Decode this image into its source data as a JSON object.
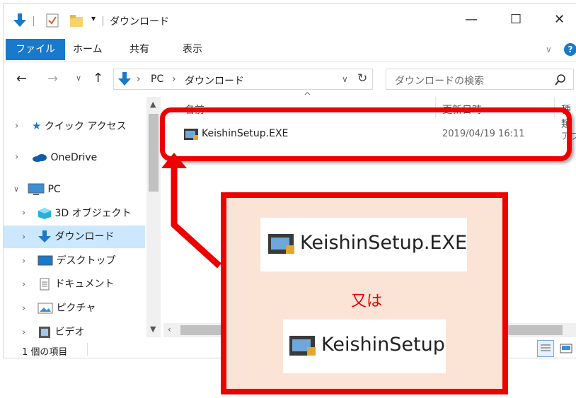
{
  "window": {
    "title": "ダウンロード",
    "qat_dropdown": "▾",
    "controls": {
      "minimize": "—",
      "maximize": "☐",
      "close": "✕"
    }
  },
  "ribbon": {
    "tabs": [
      "ファイル",
      "ホーム",
      "共有",
      "表示"
    ],
    "expand_chevron": "∨",
    "help": "?"
  },
  "nav": {
    "back": "←",
    "forward": "→",
    "recent": "∨",
    "up": "↑",
    "breadcrumb": [
      "PC",
      "ダウンロード"
    ],
    "breadcrumb_sep": "›",
    "dropdown": "∨",
    "refresh": "↻",
    "search_placeholder": "ダウンロードの検索"
  },
  "sidebar": {
    "items": [
      {
        "label": "クイック アクセス",
        "icon": "star-icon",
        "chevron": "›"
      },
      {
        "label": "OneDrive",
        "icon": "cloud-icon",
        "chevron": "›"
      },
      {
        "label": "PC",
        "icon": "monitor-icon",
        "chevron": "∨"
      },
      {
        "label": "3D オブジェクト",
        "icon": "cube-icon",
        "chevron": "›"
      },
      {
        "label": "ダウンロード",
        "icon": "download-icon",
        "chevron": "›",
        "selected": true
      },
      {
        "label": "デスクトップ",
        "icon": "desktop-icon",
        "chevron": "›"
      },
      {
        "label": "ドキュメント",
        "icon": "document-icon",
        "chevron": "›"
      },
      {
        "label": "ピクチャ",
        "icon": "picture-icon",
        "chevron": "›"
      },
      {
        "label": "ビデオ",
        "icon": "video-icon",
        "chevron": "›"
      }
    ]
  },
  "file_list": {
    "columns": [
      "名前",
      "更新日時",
      "種類"
    ],
    "sort_indicator": "^",
    "rows": [
      {
        "name": "KeishinSetup.EXE",
        "modified": "2019/04/19 16:11",
        "type": "アプ"
      }
    ]
  },
  "status": {
    "count": "1 個の項目"
  },
  "callout": {
    "file_name_1": "KeishinSetup.EXE",
    "or_text": "又は",
    "file_name_2": "KeishinSetup"
  },
  "colors": {
    "accent": "#1979ca",
    "highlight_red": "#ee0000",
    "callout_bg": "#fbe4d6",
    "selected_row": "#cce8ff"
  }
}
